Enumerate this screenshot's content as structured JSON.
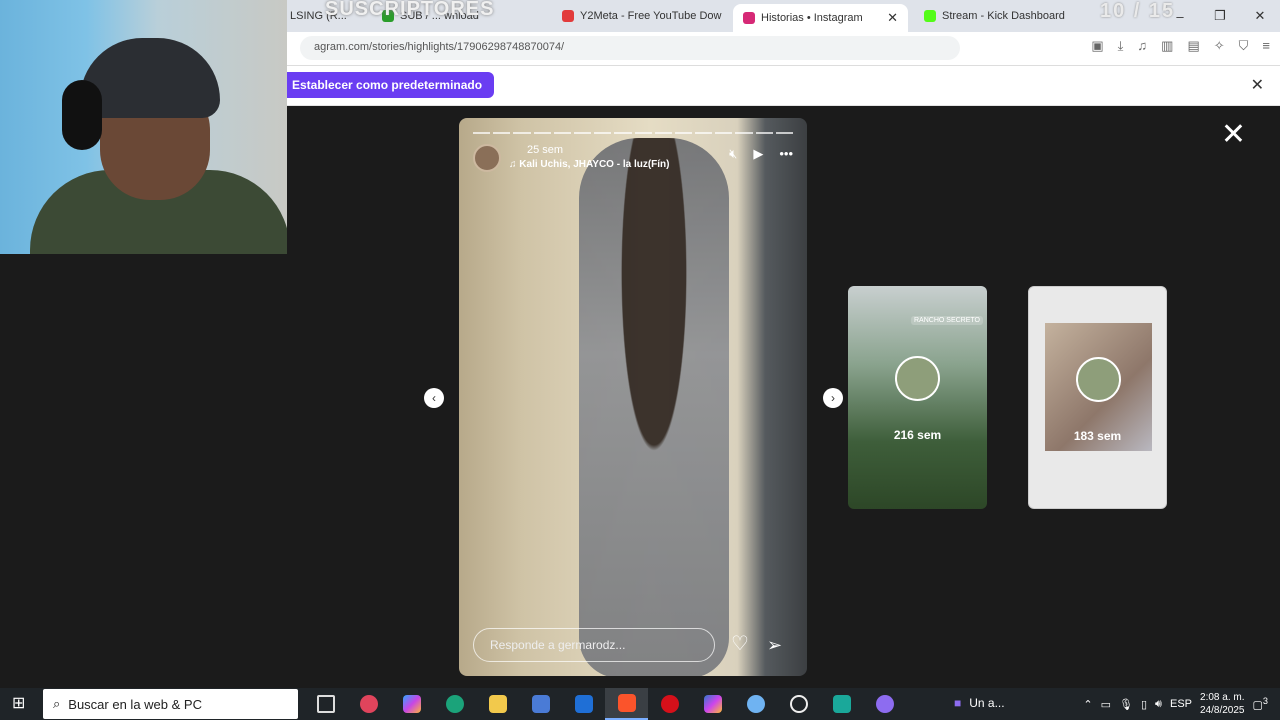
{
  "overlay": {
    "subs": "SUSCRIPTORES",
    "counter": "10 / 15"
  },
  "tabs": [
    {
      "label": "LSING (R...",
      "favicon": "#999999"
    },
    {
      "label": "SUB / ... wnload",
      "favicon": "#2a9d2a"
    },
    {
      "label": "Y2Meta - Free YouTube Dow",
      "favicon": "#e23b3b"
    },
    {
      "label": "Historias • Instagram",
      "favicon": "#d62976",
      "active": true
    },
    {
      "label": "Stream - Kick Dashboard",
      "favicon": "#53fc18"
    }
  ],
  "address": {
    "url": "agram.com/stories/highlights/17906298748870074/"
  },
  "infobar": {
    "button": "Establecer como predeterminado"
  },
  "story": {
    "time": "25 sem",
    "music": "Kali Uchis, JHAYCO - la luz(Fín)",
    "reply_placeholder": "Responde a germarodz..."
  },
  "previews": [
    {
      "label": "216 sem",
      "tag": "RANCHO SECRETO"
    },
    {
      "label": "183 sem"
    }
  ],
  "taskbar": {
    "search_placeholder": "Buscar en la web & PC",
    "weather": "Un a...",
    "lang": "ESP",
    "time": "2:08 a. m.",
    "date": "24/8/2025",
    "notification_count": "3"
  },
  "colors": {
    "accent": "#6a3df2",
    "viewer_bg": "#1b1b1b",
    "taskbar_bg": "#1f2428"
  }
}
